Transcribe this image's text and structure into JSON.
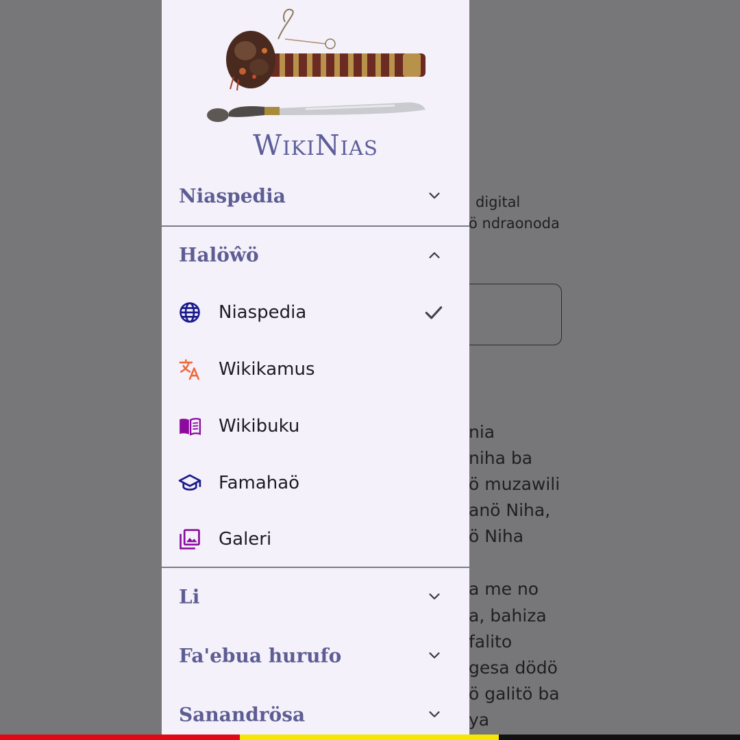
{
  "brand": {
    "name": "WikiNias",
    "colors": {
      "primary": "#5d5d93",
      "drawer_bg": "#f4f1fa",
      "scrim": "#777779"
    }
  },
  "background_page": {
    "lines_small": [
      "digital",
      "ö ndraonoda"
    ],
    "lines_large": [
      "nia",
      "niha ba",
      "ö muzawili",
      "anö Niha,",
      "ö Niha",
      "a me no",
      "a, bahiza",
      "falito",
      "gesa dödö",
      "ö galitö ba",
      "ya"
    ]
  },
  "drawer": {
    "sections": [
      {
        "title": "Niaspedia",
        "expanded": false,
        "icon": "chevron-down-icon"
      },
      {
        "title": "Halöŵö",
        "expanded": true,
        "icon": "chevron-up-icon"
      },
      {
        "title": "Li",
        "expanded": false,
        "icon": "chevron-down-icon"
      },
      {
        "title": "Fa'ebua hurufo",
        "expanded": false,
        "icon": "chevron-down-icon"
      },
      {
        "title": "Sanandrösa",
        "expanded": false,
        "icon": "chevron-down-icon"
      }
    ],
    "pages": [
      {
        "label": "Niaspedia",
        "icon": "globe-icon",
        "color": "#1a1a8c",
        "selected": true
      },
      {
        "label": "Wikikamus",
        "icon": "translate-icon",
        "color": "#f2683a",
        "selected": false
      },
      {
        "label": "Wikibuku",
        "icon": "book-icon",
        "color": "#8a0b9e",
        "selected": false
      },
      {
        "label": "Famahaö",
        "icon": "school-icon",
        "color": "#1a1a8c",
        "selected": false
      },
      {
        "label": "Galeri",
        "icon": "gallery-icon",
        "color": "#8a0b9e",
        "selected": false
      }
    ]
  },
  "flag_colors": [
    "#e30613",
    "#f7e600",
    "#111111"
  ]
}
